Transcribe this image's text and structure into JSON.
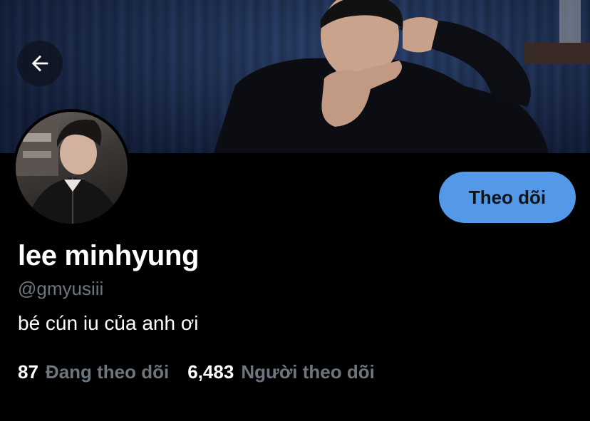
{
  "header": {
    "back_icon": "arrow-left-icon",
    "banner_image": "banner-photo"
  },
  "profile": {
    "display_name": "lee minhyung",
    "handle": "@gmyusiii",
    "bio": "bé cún iu của anh ơi",
    "avatar_image": "avatar-photo"
  },
  "actions": {
    "follow_label": "Theo dõi"
  },
  "stats": {
    "following_count": "87",
    "following_label": "Đang theo dõi",
    "followers_count": "6,483",
    "followers_label": "Người theo dõi"
  },
  "colors": {
    "background": "#000000",
    "follow_button_bg": "#5399e8",
    "secondary_text": "#6e767d",
    "primary_text": "#ffffff"
  }
}
